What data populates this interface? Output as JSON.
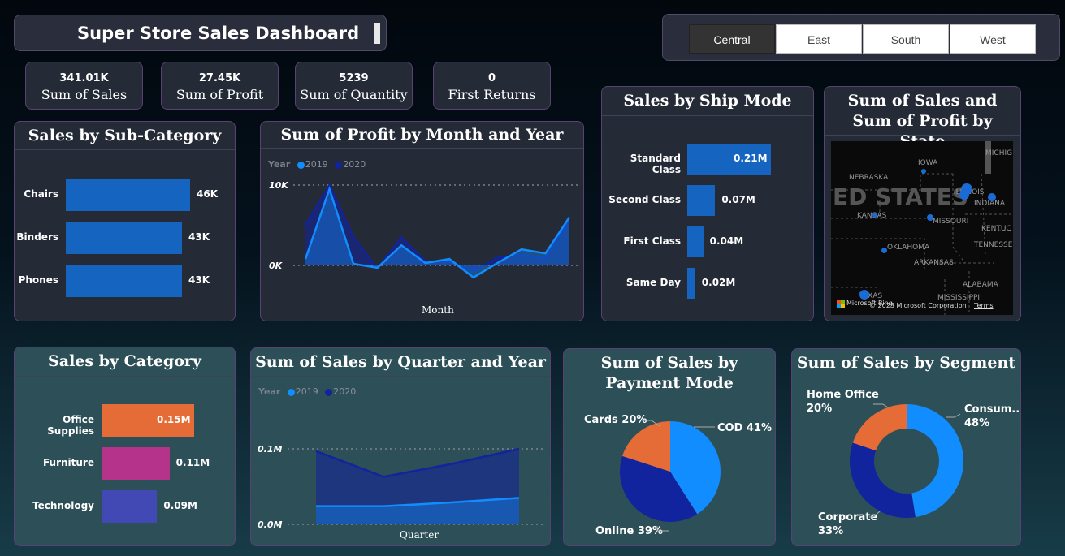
{
  "dashboard": {
    "title": "Super Store Sales Dashboard"
  },
  "region_slicer": {
    "options": [
      "Central",
      "East",
      "South",
      "West"
    ],
    "selected": "Central"
  },
  "kpis": [
    {
      "value": "341.01K",
      "label": "Sum of Sales"
    },
    {
      "value": "27.45K",
      "label": "Sum of Profit"
    },
    {
      "value": "5239",
      "label": "Sum of Quantity"
    },
    {
      "value": "0",
      "label": "First Returns"
    }
  ],
  "sub_category": {
    "title": "Sales by Sub-Category"
  },
  "profit_month": {
    "title": "Sum of Profit by Month and Year",
    "legend_title": "Year",
    "series_names": [
      "2019",
      "2020"
    ],
    "y_ticks": [
      "10K",
      "0K"
    ],
    "x_label": "Month"
  },
  "ship_mode": {
    "title": "Sales by Ship Mode"
  },
  "map": {
    "title": "Sum of Sales and Sum of Profit by State",
    "watermark": "ED STATES",
    "copyright": "© 2023 Microsoft Corporation",
    "terms": "Terms",
    "brand": "Microsoft Bing",
    "states": [
      "NEBRASKA",
      "IOWA",
      "KANSAS",
      "MISSOURI",
      "OKLAHOMA",
      "ARKANSAS",
      "TEXAS",
      "MISSISSIPPI",
      "ALABAMA",
      "TENNESSEE",
      "KENTUC",
      "INDIANA",
      "ILLINOIS",
      "MICHIG"
    ]
  },
  "category": {
    "title": "Sales by Category"
  },
  "quarter": {
    "title": "Sum of Sales by Quarter and Year",
    "legend_title": "Year",
    "series_names": [
      "2019",
      "2020"
    ],
    "y_ticks": [
      "0.1M",
      "0.0M"
    ],
    "x_label": "Quarter"
  },
  "payment": {
    "title": "Sum of Sales by Payment Mode"
  },
  "segment": {
    "title": "Sum of Sales by Segment"
  },
  "colors": {
    "bar_blue": "#1564c0",
    "series_2019": "#118dff",
    "series_2020": "#12239e",
    "orange": "#e66c37",
    "magenta": "#b6338c",
    "purple": "#4349b4"
  },
  "chart_data": [
    {
      "type": "bar",
      "orientation": "horizontal",
      "categories": [
        "Chairs",
        "Binders",
        "Phones"
      ],
      "values": [
        46000,
        43000,
        43000
      ],
      "value_labels": [
        "46K",
        "43K",
        "43K"
      ]
    },
    {
      "type": "area",
      "x": [
        1,
        2,
        3,
        4,
        5,
        6,
        7,
        8,
        9,
        10,
        11,
        12
      ],
      "series": [
        {
          "name": "2019",
          "values": [
            800,
            9500,
            200,
            -300,
            2500,
            300,
            800,
            -1500,
            300,
            2000,
            1500,
            6000
          ]
        },
        {
          "name": "2020",
          "values": [
            5000,
            10000,
            3500,
            -400,
            3500,
            500,
            500,
            -800,
            1000,
            1300,
            900,
            5600
          ]
        }
      ],
      "ylim": [
        -1500,
        10500
      ]
    },
    {
      "type": "bar",
      "orientation": "horizontal",
      "categories": [
        "Standard Class",
        "Second Class",
        "First Class",
        "Same Day"
      ],
      "values": [
        0.21,
        0.07,
        0.04,
        0.02
      ],
      "value_labels": [
        "0.21M",
        "0.07M",
        "0.04M",
        "0.02M"
      ]
    },
    {
      "type": "bar",
      "orientation": "horizontal",
      "categories": [
        "Office Supplies",
        "Furniture",
        "Technology"
      ],
      "values": [
        0.15,
        0.11,
        0.09
      ],
      "value_labels": [
        "0.15M",
        "0.11M",
        "0.09M"
      ],
      "colors": [
        "#e66c37",
        "#b6338c",
        "#4349b4"
      ]
    },
    {
      "type": "area",
      "x": [
        1,
        2,
        3,
        4
      ],
      "series": [
        {
          "name": "2019",
          "values": [
            0.024,
            0.024,
            0.029,
            0.035
          ]
        },
        {
          "name": "2020",
          "values": [
            0.097,
            0.063,
            0.08,
            0.1
          ]
        }
      ],
      "ylim": [
        0,
        0.1
      ]
    },
    {
      "type": "pie",
      "categories": [
        "COD",
        "Online",
        "Cards"
      ],
      "values": [
        41,
        39,
        20
      ],
      "labels": [
        "COD 41%",
        "Online 39%",
        "Cards 20%"
      ],
      "colors": [
        "#118dff",
        "#12239e",
        "#e66c37"
      ]
    },
    {
      "type": "pie",
      "donut": true,
      "categories": [
        "Consum...",
        "Corporate",
        "Home Office"
      ],
      "values": [
        48,
        33,
        20
      ],
      "labels": [
        "48%",
        "33%",
        "20%"
      ],
      "colors": [
        "#118dff",
        "#12239e",
        "#e66c37"
      ]
    }
  ]
}
